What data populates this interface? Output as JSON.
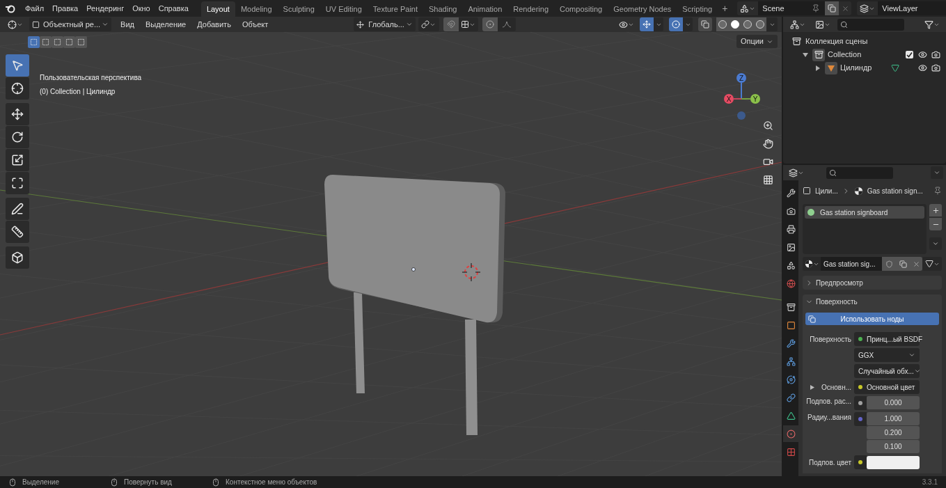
{
  "menu": [
    {
      "label": "Файл"
    },
    {
      "label": "Правка"
    },
    {
      "label": "Рендеринг"
    },
    {
      "label": "Окно"
    },
    {
      "label": "Справка"
    }
  ],
  "workspaces": [
    {
      "label": "Layout",
      "selected": true
    },
    {
      "label": "Modeling",
      "selected": false
    },
    {
      "label": "Sculpting",
      "selected": false
    },
    {
      "label": "UV Editing",
      "selected": false
    },
    {
      "label": "Texture Paint",
      "selected": false
    },
    {
      "label": "Shading",
      "selected": false
    },
    {
      "label": "Animation",
      "selected": false
    },
    {
      "label": "Rendering",
      "selected": false
    },
    {
      "label": "Compositing",
      "selected": false
    },
    {
      "label": "Geometry Nodes",
      "selected": false
    },
    {
      "label": "Scripting",
      "selected": false
    }
  ],
  "add_workspace": "+",
  "scene": "Scene",
  "view_layer": "ViewLayer",
  "viewport_header": {
    "mode": "Объектный ре...",
    "menus": [
      "Вид",
      "Выделение",
      "Добавить",
      "Объект"
    ],
    "orientation": "Глобаль...",
    "options": "Опции",
    "toggles": [
      {
        "kind": "gizmos",
        "on": true
      },
      {
        "kind": "overlays",
        "on": true
      },
      {
        "kind": "xray",
        "on": false
      }
    ]
  },
  "select_modes": [
    {
      "selected": true
    },
    {
      "selected": false
    },
    {
      "selected": false
    },
    {
      "selected": false
    },
    {
      "selected": false
    }
  ],
  "shading_modes": [
    {
      "selected": false
    },
    {
      "selected": true
    },
    {
      "selected": false
    },
    {
      "selected": false
    }
  ],
  "tools": [
    {
      "kind": "select",
      "selected": true
    },
    {
      "kind": "cursor",
      "selected": false
    },
    {
      "kind": "move",
      "selected": false
    },
    {
      "kind": "rotate",
      "selected": false
    },
    {
      "kind": "scale",
      "selected": false
    },
    {
      "kind": "transform",
      "selected": false
    },
    {
      "kind": "annotate",
      "selected": false
    },
    {
      "kind": "measure",
      "selected": false
    },
    {
      "kind": "add_cube",
      "selected": false
    }
  ],
  "viewport_info": [
    "Пользовательская перспектива",
    "(0) Collection | Цилиндр"
  ],
  "gizmo": {
    "x": "X",
    "y": "Y",
    "z": "Z"
  },
  "outliner": {
    "items": [
      {
        "name": "Коллекция сцены",
        "kind": "scene_collection",
        "children": [
          {
            "name": "Collection",
            "kind": "collection",
            "expanded": true,
            "checked": true,
            "children": [
              {
                "name": "Цилиндр",
                "kind": "mesh",
                "expanded": false
              }
            ]
          }
        ]
      }
    ]
  },
  "properties": {
    "breadcrumb": [
      "Цили...",
      "Gas station sign..."
    ],
    "tabs": [
      {
        "kind": "tool",
        "selected": false
      },
      {
        "kind": "render",
        "selected": false
      },
      {
        "kind": "output",
        "selected": false
      },
      {
        "kind": "view_layer",
        "selected": false
      },
      {
        "kind": "scene",
        "selected": false
      },
      {
        "kind": "world",
        "selected": false
      },
      {
        "kind": "collection",
        "selected": false
      },
      {
        "kind": "object",
        "selected": false
      },
      {
        "kind": "modifiers",
        "selected": false
      },
      {
        "kind": "particles",
        "selected": false
      },
      {
        "kind": "physics",
        "selected": false
      },
      {
        "kind": "constraints",
        "selected": false
      },
      {
        "kind": "data",
        "selected": false
      },
      {
        "kind": "material",
        "selected": true
      },
      {
        "kind": "texture",
        "selected": false
      }
    ],
    "material_slots": [
      {
        "name": "Gas station signboard",
        "selected": true
      }
    ],
    "material_name": "Gas station sig...",
    "panels": [
      {
        "title": "Предпросмотр",
        "expanded": false
      },
      {
        "title": "Поверхность",
        "expanded": true
      }
    ],
    "use_nodes": "Использовать ноды",
    "rows": [
      {
        "kind": "socket",
        "label": "Поверхность",
        "value": "Принц...ый BSDF",
        "color": "#4caf50"
      },
      {
        "kind": "dropdown",
        "value": "GGX"
      },
      {
        "kind": "dropdown",
        "value": "Случайный обх..."
      },
      {
        "kind": "socket",
        "label": "Основн...",
        "value": "Основной цвет",
        "color": "#c7c729",
        "expandable": true
      },
      {
        "kind": "number",
        "label": "Подпов. рас...",
        "values": [
          "0.000"
        ],
        "color": "#a1a1a1"
      },
      {
        "kind": "number",
        "label": "Радиу...вания",
        "values": [
          "1.000",
          "0.200",
          "0.100"
        ],
        "color": "#6363c7"
      },
      {
        "kind": "swatch",
        "label": "Подпов. цвет",
        "color": "#c7c729"
      }
    ]
  },
  "status_bar": [
    {
      "label": "Выделение"
    },
    {
      "label": "Повернуть вид"
    },
    {
      "label": "Контекстное меню объектов"
    }
  ],
  "version": "3.3.1"
}
